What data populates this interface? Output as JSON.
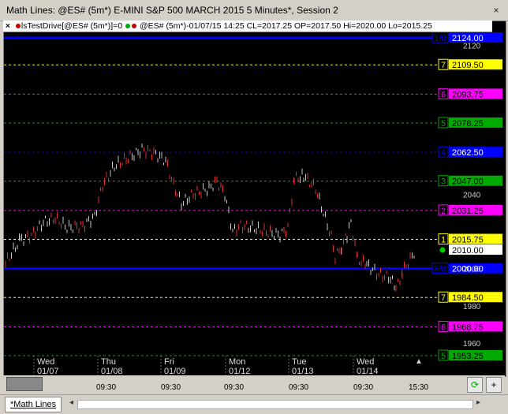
{
  "window": {
    "title": "Math Lines: @ES# (5m*) E-MINI S&P 500 MARCH 2015 5 Minutes*, Session 2",
    "close_label": "×"
  },
  "infobar": {
    "text1": "lsTestDrive[@ES# (5m*)]=0",
    "text2": "@ES# (5m*)-01/07/15 14:25 CL=2017.25 OP=2017.50 Hi=2020.00 Lo=2015.25"
  },
  "price_axis": {
    "ticks": [
      "2120",
      "2040",
      "2000",
      "1980",
      "1960"
    ]
  },
  "math_lines": [
    {
      "label": "1/8",
      "price": "2124.00",
      "color": "#0000ff"
    },
    {
      "label": "7",
      "price": "2109.50",
      "color": "#ffff00"
    },
    {
      "label": "6",
      "price": "2093.75",
      "color": "#ff00ff"
    },
    {
      "label": "5",
      "price": "2078.25",
      "color": "#00aa00"
    },
    {
      "label": "4",
      "price": "2062.50",
      "color": "#0000ff"
    },
    {
      "label": "3",
      "price": "2047.00",
      "color": "#00aa00"
    },
    {
      "label": "2",
      "price": "2031.25",
      "color": "#ff00ff"
    },
    {
      "label": "1",
      "price": "2015.75",
      "color": "#ffff00"
    },
    {
      "label": "8/8",
      "price": "2000.00",
      "color": "#0000ff"
    },
    {
      "label": "7",
      "price": "1984.50",
      "color": "#ffff00"
    },
    {
      "label": "6",
      "price": "1968.75",
      "color": "#ff00ff"
    },
    {
      "label": "5",
      "price": "1953.25",
      "color": "#00aa00"
    }
  ],
  "last_price": "2010.00",
  "dates": [
    {
      "day": "Wed",
      "date": "01/07"
    },
    {
      "day": "Thu",
      "date": "01/08"
    },
    {
      "day": "Fri",
      "date": "01/09"
    },
    {
      "day": "Mon",
      "date": "01/12"
    },
    {
      "day": "Tue",
      "date": "01/13"
    },
    {
      "day": "Wed",
      "date": "01/14"
    }
  ],
  "times": [
    "09:30",
    "09:30",
    "09:30",
    "09:30",
    "09:30",
    "15:30"
  ],
  "tabs": {
    "active": "*Math Lines",
    "add_label": "+"
  },
  "icons": {
    "refresh": "refresh-icon",
    "add": "plus-icon"
  }
}
